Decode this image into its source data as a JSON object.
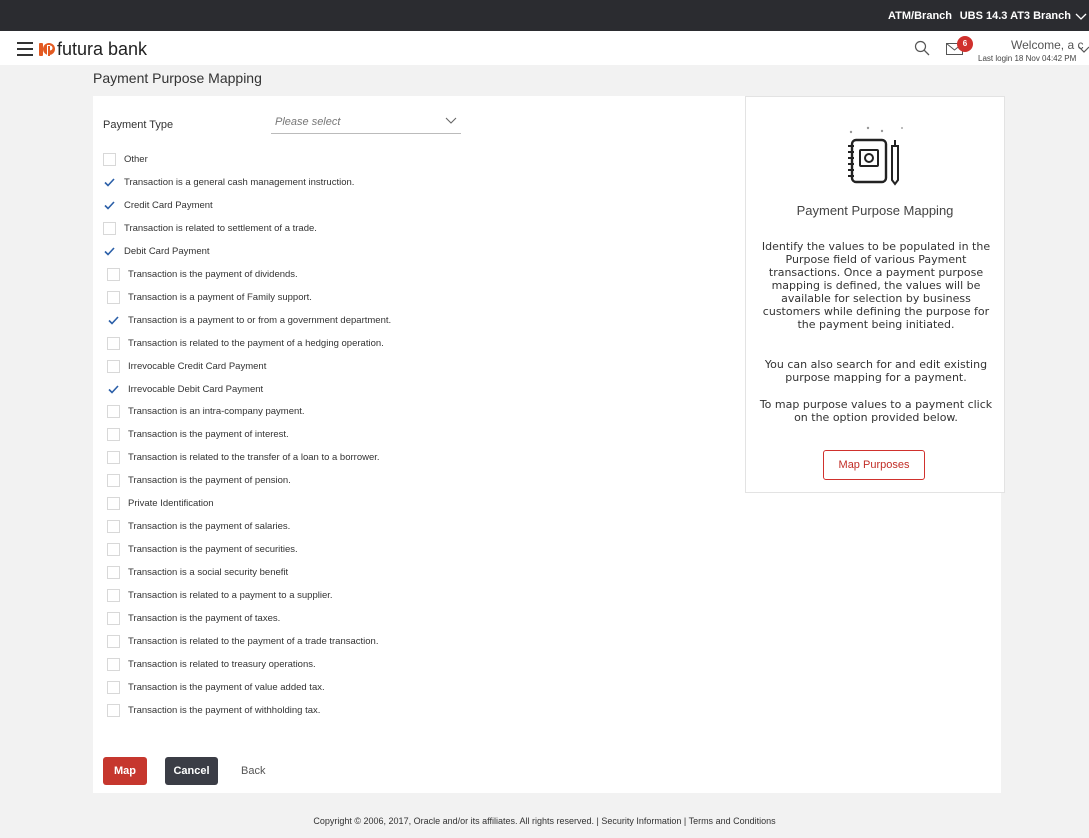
{
  "topbar": {
    "atm_label": "ATM/Branch",
    "branch_label": "UBS 14.3 AT3 Branch"
  },
  "header": {
    "logo_text": "futura bank",
    "mail_badge_count": "6",
    "welcome_text": "Welcome, a c",
    "last_login": "Last login 18 Nov 04:42 PM"
  },
  "page": {
    "title": "Payment Purpose Mapping"
  },
  "form": {
    "payment_type_label": "Payment Type",
    "payment_type_placeholder": "Please select",
    "purposes": [
      {
        "label": "Other",
        "checked": false
      },
      {
        "label": "Transaction is a general cash management instruction.",
        "checked": true
      },
      {
        "label": "Credit Card Payment",
        "checked": true
      },
      {
        "label": "Transaction is related to settlement of a trade.",
        "checked": false
      },
      {
        "label": "Debit Card Payment",
        "checked": true
      },
      {
        "label": "Transaction is the payment of dividends.",
        "checked": false
      },
      {
        "label": "Transaction is a payment of Family support.",
        "checked": false
      },
      {
        "label": "Transaction is a payment to or from a government department.",
        "checked": true
      },
      {
        "label": "Transaction is related to the payment of a hedging operation.",
        "checked": false
      },
      {
        "label": "Irrevocable Credit Card Payment",
        "checked": false
      },
      {
        "label": "Irrevocable Debit Card Payment",
        "checked": true
      },
      {
        "label": "Transaction is an intra-company payment.",
        "checked": false
      },
      {
        "label": "Transaction is the payment of interest.",
        "checked": false
      },
      {
        "label": "Transaction is related to the transfer of a loan to a borrower.",
        "checked": false
      },
      {
        "label": "Transaction is the payment of pension.",
        "checked": false
      },
      {
        "label": "Private Identification",
        "checked": false
      },
      {
        "label": "Transaction is the payment of salaries.",
        "checked": false
      },
      {
        "label": "Transaction is the payment of securities.",
        "checked": false
      },
      {
        "label": "Transaction is a social security benefit",
        "checked": false
      },
      {
        "label": "Transaction is related to a payment to a supplier.",
        "checked": false
      },
      {
        "label": "Transaction is the payment of taxes.",
        "checked": false
      },
      {
        "label": "Transaction is related to the payment of a trade transaction.",
        "checked": false
      },
      {
        "label": "Transaction is related to treasury operations.",
        "checked": false
      },
      {
        "label": "Transaction is the payment of value added tax.",
        "checked": false
      },
      {
        "label": "Transaction is the payment of withholding tax.",
        "checked": false
      }
    ]
  },
  "info": {
    "title": "Payment Purpose Mapping",
    "para1": "Identify the values to be populated in the Purpose field of various Payment transactions. Once a payment purpose mapping is defined, the values will be available for selection by business customers while defining the purpose for the payment being initiated.",
    "para2": "You can also search for and edit existing purpose mapping for a payment.",
    "para3": "To map purpose values to a payment click on the option provided below.",
    "button": "Map Purposes"
  },
  "actions": {
    "map": "Map",
    "cancel": "Cancel",
    "back": "Back"
  },
  "footer": {
    "copyright": "Copyright © 2006, 2017, Oracle and/or its affiliates. All rights reserved.",
    "sep": " | ",
    "security": "Security Information",
    "terms": "Terms and Conditions"
  },
  "colors": {
    "accent": "#c6372e",
    "dark": "#2b2c30",
    "check": "#2b5fa8"
  }
}
